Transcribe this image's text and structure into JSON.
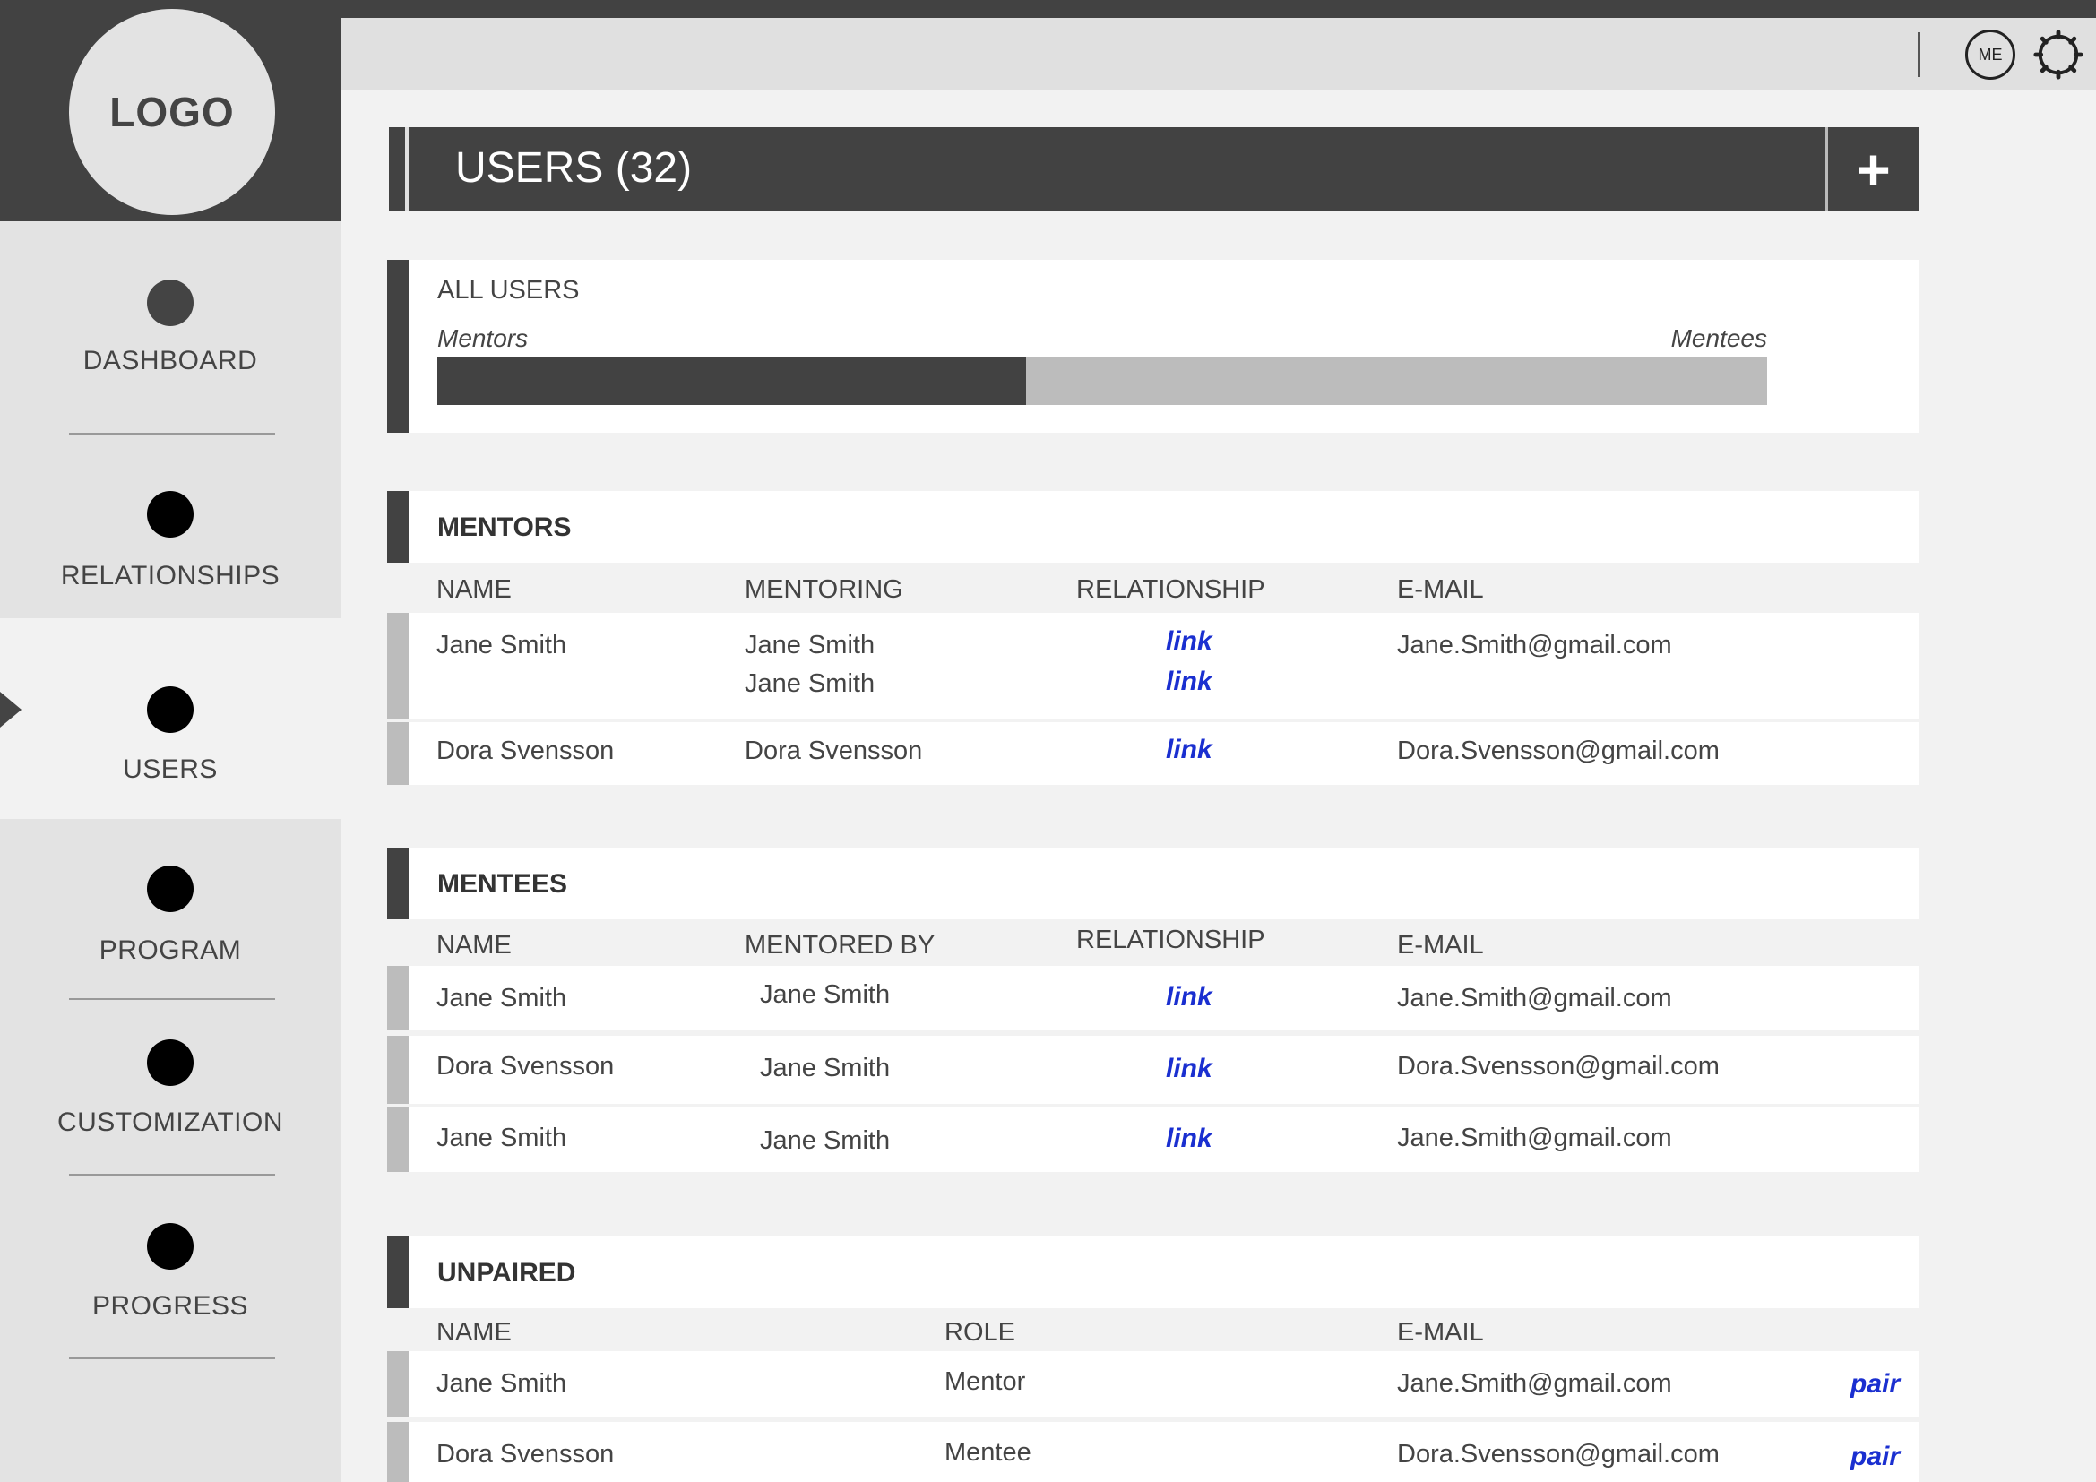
{
  "sidebar": {
    "logo": "LOGO",
    "items": [
      {
        "label": "DASHBOARD"
      },
      {
        "label": "RELATIONSHIPS"
      },
      {
        "label": "USERS"
      },
      {
        "label": "PROGRAM"
      },
      {
        "label": "CUSTOMIZATION"
      },
      {
        "label": "PROGRESS"
      }
    ]
  },
  "header": {
    "me_label": "ME"
  },
  "page": {
    "title": "USERS (32)",
    "add_label": "+"
  },
  "all_users": {
    "title": "ALL USERS",
    "left_label": "Mentors",
    "right_label": "Mentees",
    "mentor_fraction": 0.443
  },
  "mentors": {
    "title": "MENTORS",
    "columns": [
      "NAME",
      "MENTORING",
      "RELATIONSHIP",
      "E-MAIL"
    ],
    "rows": [
      {
        "name": "Jane Smith",
        "mentoring": [
          "Jane Smith",
          "Jane Smith"
        ],
        "links": [
          "link",
          "link"
        ],
        "email": "Jane.Smith@gmail.com"
      },
      {
        "name": "Dora Svensson",
        "mentoring": [
          "Dora Svensson"
        ],
        "links": [
          "link"
        ],
        "email": "Dora.Svensson@gmail.com"
      }
    ]
  },
  "mentees": {
    "title": "MENTEES",
    "columns": [
      "NAME",
      "MENTORED BY",
      "RELATIONSHIP",
      "E-MAIL"
    ],
    "rows": [
      {
        "name": "Jane Smith",
        "mentored_by": "Jane Smith",
        "link": "link",
        "email": "Jane.Smith@gmail.com"
      },
      {
        "name": "Dora Svensson",
        "mentored_by": "Jane Smith",
        "link": "link",
        "email": "Dora.Svensson@gmail.com"
      },
      {
        "name": "Jane Smith",
        "mentored_by": "Jane Smith",
        "link": "link",
        "email": "Jane.Smith@gmail.com"
      }
    ]
  },
  "unpaired": {
    "title": "UNPAIRED",
    "columns": [
      "NAME",
      "ROLE",
      "E-MAIL"
    ],
    "rows": [
      {
        "name": "Jane Smith",
        "role": "Mentor",
        "email": "Jane.Smith@gmail.com",
        "action": "pair"
      },
      {
        "name": "Dora Svensson",
        "role": "Mentee",
        "email": "Dora.Svensson@gmail.com",
        "action": "pair"
      }
    ]
  },
  "colors": {
    "dark": "#424242",
    "light": "#e3e3e3",
    "link": "#1a2fd0",
    "row_marker": "#bcbcbc"
  }
}
